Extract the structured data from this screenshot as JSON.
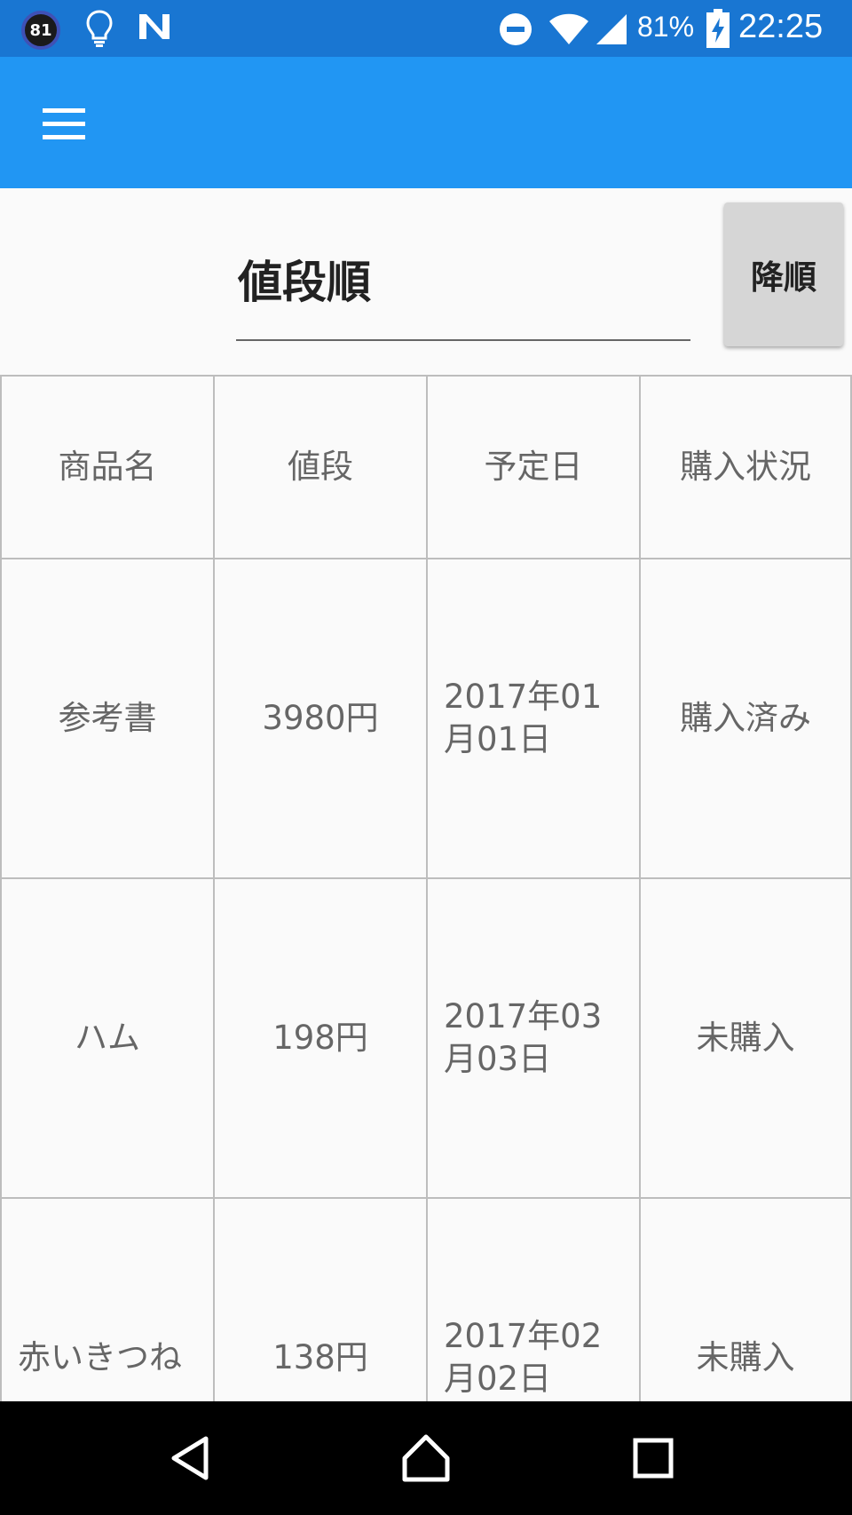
{
  "status_bar": {
    "badge": "81",
    "battery": "81%",
    "time": "22:25",
    "icons": [
      "lightbulb-icon",
      "n-logo-icon",
      "do-not-disturb-icon",
      "wifi-icon",
      "signal-icon",
      "battery-charging-icon"
    ]
  },
  "toolbar": {
    "menu_icon": "hamburger-menu-icon"
  },
  "sort": {
    "selected": "値段順",
    "order_button": "降順"
  },
  "table": {
    "headers": [
      "商品名",
      "値段",
      "予定日",
      "購入状況"
    ],
    "rows": [
      {
        "name": "参考書",
        "price": "3980円",
        "date": "2017年01月01日",
        "status": "購入済み"
      },
      {
        "name": "ハム",
        "price": "198円",
        "date": "2017年03月03日",
        "status": "未購入"
      },
      {
        "name": "赤いきつね",
        "price": "138円",
        "date": "2017年02月02日",
        "status": "未購入"
      }
    ]
  },
  "nav": {
    "icons": [
      "back-icon",
      "home-icon",
      "recents-icon"
    ]
  },
  "colors": {
    "status_bar": "#1976d2",
    "app_bar": "#2196f3",
    "grid": "#bdbdbd",
    "cell_text": "#666666"
  }
}
